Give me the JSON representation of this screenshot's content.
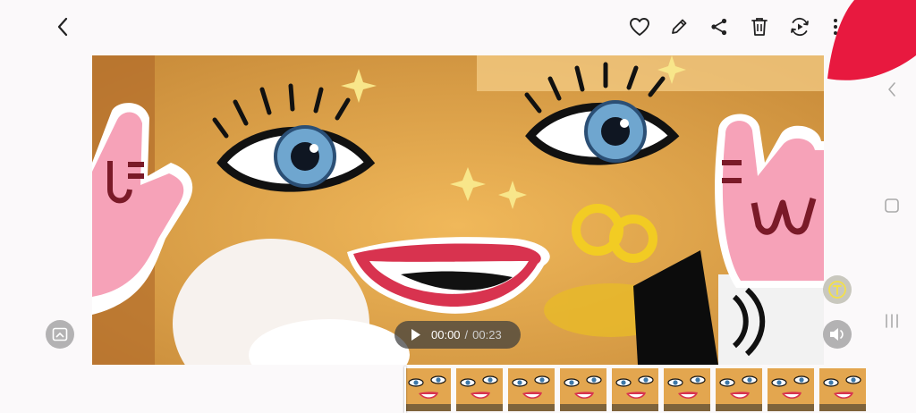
{
  "toolbar": {
    "back": "back-icon",
    "favorite": "heart-icon",
    "edit": "pencil-icon",
    "share": "share-icon",
    "delete": "trash-icon",
    "remaster": "video-remaster-icon",
    "more": "more-vertical-icon"
  },
  "player": {
    "time_current": "00:00",
    "time_separator": "/",
    "time_total": "00:23",
    "progress": 0
  },
  "side_nav": {
    "back": "chevron-left-icon",
    "home": "square-icon",
    "recents": "recents-icon"
  },
  "controls": {
    "capture": "screen-capture-icon",
    "text_extract": "text-extract-icon",
    "volume": "volume-icon"
  },
  "filmstrip": {
    "frame_count": 9
  },
  "colors": {
    "video_bg": "#e4a44c",
    "accent_red": "#e8193f",
    "pill_bg": "#3c3c3c",
    "icon_dark": "#222222"
  }
}
